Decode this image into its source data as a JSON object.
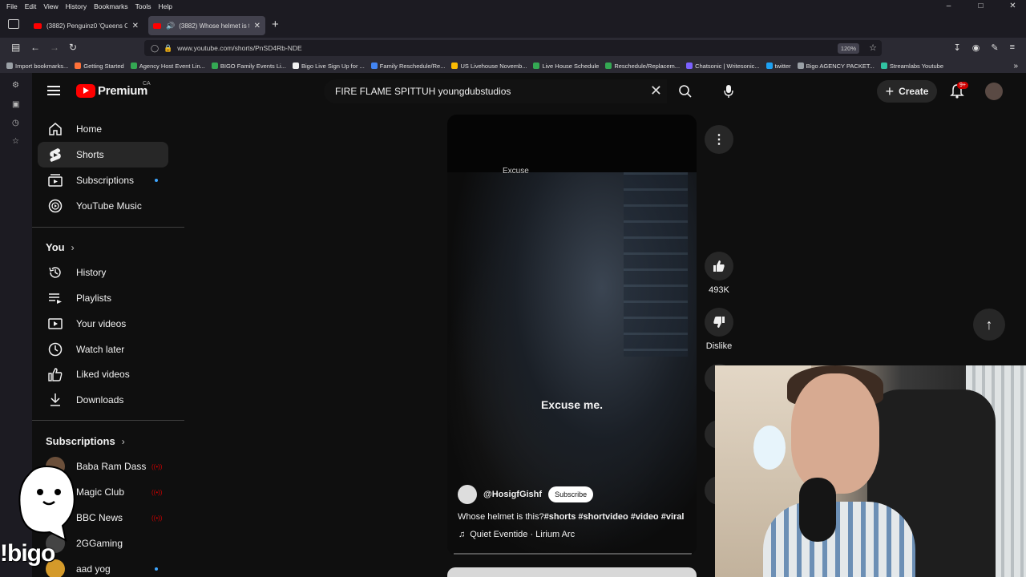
{
  "browser": {
    "menu": [
      "File",
      "Edit",
      "View",
      "History",
      "Bookmarks",
      "Tools",
      "Help"
    ],
    "tabs": [
      {
        "label": "(3882) Penguinz0 'Queens Cring"
      },
      {
        "label": "(3882) Whose helmet is thi"
      }
    ],
    "url": "www.youtube.com/shorts/PnSD4Rb-NDE",
    "zoom": "120%",
    "bookmarks": [
      {
        "label": "Import bookmarks...",
        "color": "#9aa0a6"
      },
      {
        "label": "Getting Started",
        "color": "#ff7139"
      },
      {
        "label": "Agency Host Event Lin...",
        "color": "#34a853"
      },
      {
        "label": "BIGO Family Events Li...",
        "color": "#34a853"
      },
      {
        "label": "Bigo Live Sign Up for ...",
        "color": "#f2f2f2"
      },
      {
        "label": "Family Reschedule/Re...",
        "color": "#4285f4"
      },
      {
        "label": "US Livehouse Novemb...",
        "color": "#fbbc04"
      },
      {
        "label": "Live House Schedule",
        "color": "#34a853"
      },
      {
        "label": "Reschedule/Replacem...",
        "color": "#34a853"
      },
      {
        "label": "Chatsonic | Writesonic...",
        "color": "#7b61ff"
      },
      {
        "label": "twitter",
        "color": "#1da1f2"
      },
      {
        "label": "Bigo AGENCY PACKET...",
        "color": "#9aa0a6"
      },
      {
        "label": "Streamlabs Youtube",
        "color": "#31c3a2"
      }
    ]
  },
  "youtube": {
    "logo_text": "Premium",
    "region": "CA",
    "search_query": "FIRE FLAME SPITTUH youngdubstudios",
    "create_label": "Create",
    "notif_badge": "9+",
    "nav_main": [
      {
        "label": "Home",
        "icon": "home-icon"
      },
      {
        "label": "Shorts",
        "icon": "shorts-icon"
      },
      {
        "label": "Subscriptions",
        "icon": "subscriptions-icon"
      },
      {
        "label": "YouTube Music",
        "icon": "youtube-music-icon"
      }
    ],
    "you_title": "You",
    "nav_you": [
      {
        "label": "History",
        "icon": "history-icon"
      },
      {
        "label": "Playlists",
        "icon": "playlists-icon"
      },
      {
        "label": "Your videos",
        "icon": "your-videos-icon"
      },
      {
        "label": "Watch later",
        "icon": "watch-later-icon"
      },
      {
        "label": "Liked videos",
        "icon": "liked-videos-icon"
      },
      {
        "label": "Downloads",
        "icon": "downloads-icon"
      }
    ],
    "subs_title": "Subscriptions",
    "subscriptions": [
      {
        "label": "Baba Ram Dass",
        "status": "live"
      },
      {
        "label": "Magic Club",
        "status": "live"
      },
      {
        "label": "BBC News",
        "status": "live"
      },
      {
        "label": "2GGaming",
        "status": ""
      },
      {
        "label": "aad yog",
        "status": "new"
      }
    ],
    "short": {
      "top_caption": "Excuse",
      "caption": "Excuse me.",
      "channel": "@HosigfGishf",
      "subscribe": "Subscribe",
      "title_plain": "Whose helmet is this?",
      "hashtags": "#shorts #shortvideo #video #viral",
      "music": "Quiet Eventide · Lirium Arc"
    },
    "actions": {
      "likes": "493K",
      "dislike": "Dislike"
    }
  },
  "overlay": {
    "bigo_text": "!bigo"
  }
}
